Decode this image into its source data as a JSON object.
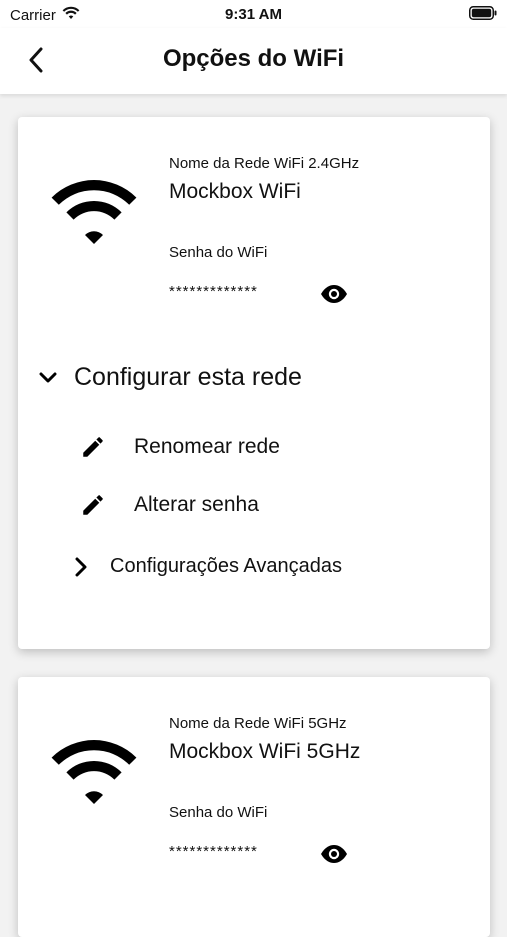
{
  "status_bar": {
    "carrier": "Carrier",
    "time": "9:31 AM"
  },
  "header": {
    "title": "Opções do WiFi"
  },
  "networks": [
    {
      "name_label": "Nome da Rede WiFi 2.4GHz",
      "name": "Mockbox WiFi",
      "password_label": "Senha do WiFi",
      "password_masked": "*************"
    },
    {
      "name_label": "Nome da Rede WiFi 5GHz",
      "name": "Mockbox WiFi 5GHz",
      "password_label": "Senha do WiFi",
      "password_masked": "*************"
    }
  ],
  "config": {
    "header": "Configurar esta rede",
    "rename": "Renomear rede",
    "change_password": "Alterar senha",
    "advanced": "Configurações Avançadas"
  },
  "icons": {
    "wifi": "wifi-icon",
    "eye": "eye-icon",
    "edit": "pencil-icon",
    "back": "chevron-left-icon"
  }
}
